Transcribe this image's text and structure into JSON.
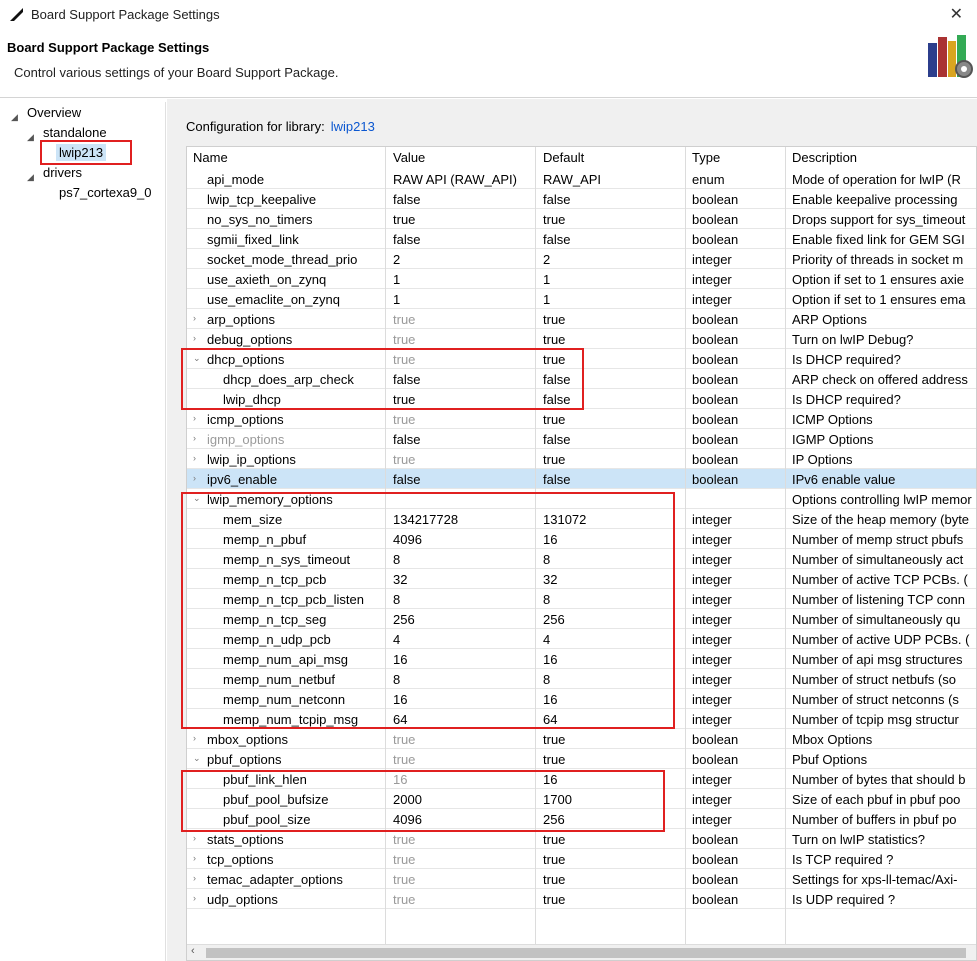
{
  "window": {
    "title": "Board Support Package Settings"
  },
  "header": {
    "title": "Board Support Package Settings",
    "subtitle": "Control various settings of your Board Support Package."
  },
  "tree": {
    "overview": "Overview",
    "standalone": "standalone",
    "lwip": "lwip213",
    "drivers": "drivers",
    "ps7": "ps7_cortexa9_0"
  },
  "config": {
    "label": "Configuration for library:",
    "library": "lwip213"
  },
  "columns": [
    "Name",
    "Value",
    "Default",
    "Type",
    "Description"
  ],
  "rows": [
    {
      "name": "api_mode",
      "value": "RAW API (RAW_API)",
      "default": "RAW_API",
      "type": "enum",
      "desc": "Mode of operation for lwIP (R"
    },
    {
      "name": "lwip_tcp_keepalive",
      "value": "false",
      "default": "false",
      "type": "boolean",
      "desc": "Enable keepalive processing"
    },
    {
      "name": "no_sys_no_timers",
      "value": "true",
      "default": "true",
      "type": "boolean",
      "desc": "Drops support for sys_timeout"
    },
    {
      "name": "sgmii_fixed_link",
      "value": "false",
      "default": "false",
      "type": "boolean",
      "desc": "Enable fixed link for GEM SGI"
    },
    {
      "name": "socket_mode_thread_prio",
      "value": "2",
      "default": "2",
      "type": "integer",
      "desc": "Priority of threads in socket m"
    },
    {
      "name": "use_axieth_on_zynq",
      "value": "1",
      "default": "1",
      "type": "integer",
      "desc": "Option if set to 1 ensures axie"
    },
    {
      "name": "use_emaclite_on_zynq",
      "value": "1",
      "default": "1",
      "type": "integer",
      "desc": "Option if set to 1 ensures ema"
    },
    {
      "name": "arp_options",
      "value": "true",
      "default": "true",
      "type": "boolean",
      "desc": "ARP Options"
    },
    {
      "name": "debug_options",
      "value": "true",
      "default": "true",
      "type": "boolean",
      "desc": "Turn on lwIP Debug?"
    },
    {
      "name": "dhcp_options",
      "value": "true",
      "default": "true",
      "type": "boolean",
      "desc": "Is DHCP required?"
    },
    {
      "name": "dhcp_does_arp_check",
      "value": "false",
      "default": "false",
      "type": "boolean",
      "desc": "ARP check on offered address"
    },
    {
      "name": "lwip_dhcp",
      "value": "true",
      "default": "false",
      "type": "boolean",
      "desc": "Is DHCP required?"
    },
    {
      "name": "icmp_options",
      "value": "true",
      "default": "true",
      "type": "boolean",
      "desc": "ICMP Options"
    },
    {
      "name": "igmp_options",
      "value": "false",
      "default": "false",
      "type": "boolean",
      "desc": "IGMP Options"
    },
    {
      "name": "lwip_ip_options",
      "value": "true",
      "default": "true",
      "type": "boolean",
      "desc": "IP Options"
    },
    {
      "name": "ipv6_enable",
      "value": "false",
      "default": "false",
      "type": "boolean",
      "desc": "IPv6 enable value"
    },
    {
      "name": "lwip_memory_options",
      "value": "",
      "default": "",
      "type": "",
      "desc": "Options controlling lwIP memor"
    },
    {
      "name": "mem_size",
      "value": "134217728",
      "default": "131072",
      "type": "integer",
      "desc": "Size of the heap memory (byte"
    },
    {
      "name": "memp_n_pbuf",
      "value": "4096",
      "default": "16",
      "type": "integer",
      "desc": "Number of memp struct pbufs"
    },
    {
      "name": "memp_n_sys_timeout",
      "value": "8",
      "default": "8",
      "type": "integer",
      "desc": "Number of simultaneously act"
    },
    {
      "name": "memp_n_tcp_pcb",
      "value": "32",
      "default": "32",
      "type": "integer",
      "desc": "Number of active TCP PCBs. ("
    },
    {
      "name": "memp_n_tcp_pcb_listen",
      "value": "8",
      "default": "8",
      "type": "integer",
      "desc": "Number of listening TCP conn"
    },
    {
      "name": "memp_n_tcp_seg",
      "value": "256",
      "default": "256",
      "type": "integer",
      "desc": "Number of simultaneously qu"
    },
    {
      "name": "memp_n_udp_pcb",
      "value": "4",
      "default": "4",
      "type": "integer",
      "desc": "Number of active UDP PCBs. ("
    },
    {
      "name": "memp_num_api_msg",
      "value": "16",
      "default": "16",
      "type": "integer",
      "desc": "Number of api msg structures"
    },
    {
      "name": "memp_num_netbuf",
      "value": "8",
      "default": "8",
      "type": "integer",
      "desc": "Number of struct netbufs (so"
    },
    {
      "name": "memp_num_netconn",
      "value": "16",
      "default": "16",
      "type": "integer",
      "desc": "Number of struct netconns (s"
    },
    {
      "name": "memp_num_tcpip_msg",
      "value": "64",
      "default": "64",
      "type": "integer",
      "desc": "Number of tcpip msg structur"
    },
    {
      "name": "mbox_options",
      "value": "true",
      "default": "true",
      "type": "boolean",
      "desc": "Mbox Options"
    },
    {
      "name": "pbuf_options",
      "value": "true",
      "default": "true",
      "type": "boolean",
      "desc": "Pbuf Options"
    },
    {
      "name": "pbuf_link_hlen",
      "value": "16",
      "default": "16",
      "type": "integer",
      "desc": "Number of bytes that should b"
    },
    {
      "name": "pbuf_pool_bufsize",
      "value": "2000",
      "default": "1700",
      "type": "integer",
      "desc": "Size of each pbuf in pbuf poo"
    },
    {
      "name": "pbuf_pool_size",
      "value": "4096",
      "default": "256",
      "type": "integer",
      "desc": "Number of buffers in pbuf po"
    },
    {
      "name": "stats_options",
      "value": "true",
      "default": "true",
      "type": "boolean",
      "desc": "Turn on lwIP statistics?"
    },
    {
      "name": "tcp_options",
      "value": "true",
      "default": "true",
      "type": "boolean",
      "desc": "Is TCP required ?"
    },
    {
      "name": "temac_adapter_options",
      "value": "true",
      "default": "true",
      "type": "boolean",
      "desc": "Settings for xps-ll-temac/Axi-"
    },
    {
      "name": "udp_options",
      "value": "true",
      "default": "true",
      "type": "boolean",
      "desc": "Is UDP required ?"
    }
  ],
  "colors": {
    "selection": "#cce4f7",
    "highlight": "#e02020",
    "link": "#0b57d0"
  },
  "icons": {
    "app": "app-logo-icon",
    "books": "books-gear-icon",
    "close": "close-icon"
  }
}
